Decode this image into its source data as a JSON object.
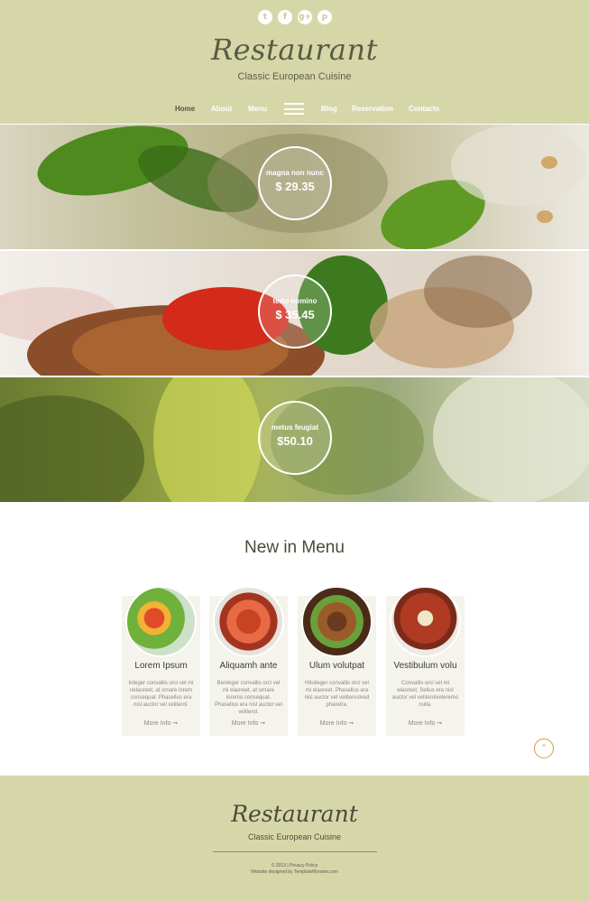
{
  "header": {
    "social": [
      {
        "icon": "twitter-icon",
        "glyph": "t"
      },
      {
        "icon": "facebook-icon",
        "glyph": "f"
      },
      {
        "icon": "googleplus-icon",
        "glyph": "g+"
      },
      {
        "icon": "pinterest-icon",
        "glyph": "p"
      }
    ],
    "logo": "Restaurant",
    "tagline": "Classic European Cuisine",
    "nav": [
      {
        "label": "Home",
        "active": true
      },
      {
        "label": "About"
      },
      {
        "label": "Menu"
      },
      {
        "label": "Blog"
      },
      {
        "label": "Reservation"
      },
      {
        "label": "Contacts"
      }
    ]
  },
  "banners": [
    {
      "name": "magna non nunc",
      "price": "$ 29.35"
    },
    {
      "name": "terto nomino",
      "price": "$ 35.45"
    },
    {
      "name": "metus feugiat",
      "price": "$50.10"
    }
  ],
  "new_in_menu": {
    "title": "New in Menu",
    "items": [
      {
        "title": "Lorem Ipsum",
        "text": "Integer convallis orci vel mi nelaoreet, at ornare lorem consequat. Phasellus era nisl auctor vel veliterol.",
        "more": "More Info"
      },
      {
        "title": "Aliquamh ante",
        "text": "Benteger convallis orci vel mi elaoreet, at ornare loremo consequat. Phasellus era nisl auctor vel veliterol.",
        "more": "More Info"
      },
      {
        "title": "Ulum volutpat",
        "text": "Hitoileger convallis orci vel mi elaoreet. Phasellus era nisl auctor vel veliteroslved pharetra.",
        "more": "More Info"
      },
      {
        "title": "Vestibulum volu",
        "text": "Convallis orci vel mi elaoreet. Sellus era nisl auctor vel veliterolveleremo nulla.",
        "more": "More Info"
      }
    ]
  },
  "footer": {
    "logo": "Restaurant",
    "tagline": "Classic European Cuisine",
    "copyright": "© 2013 | Privacy Policy",
    "credit": "Website designed by TemplateMonster.com"
  },
  "colors": {
    "header_bg": "#d6d7a9",
    "accent": "#d79a3e"
  }
}
